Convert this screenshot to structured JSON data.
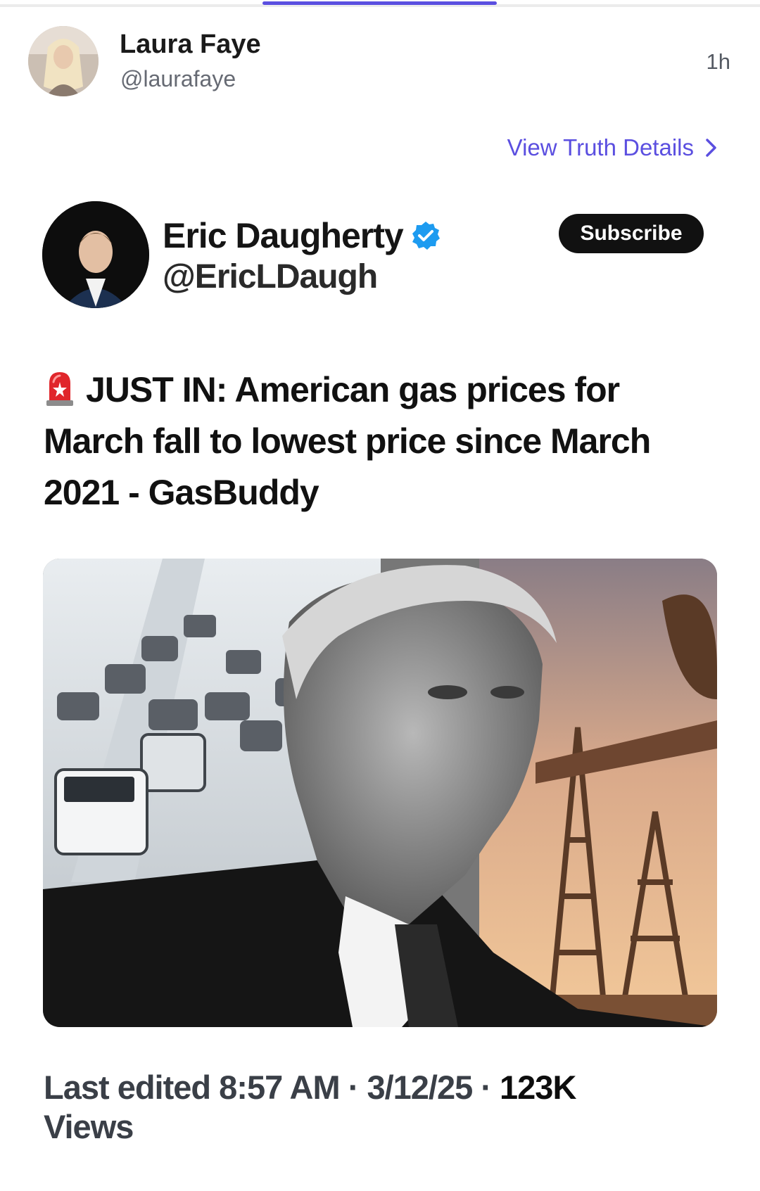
{
  "poster": {
    "name": "Laura Faye",
    "handle": "@laurafaye",
    "time": "1h",
    "view_details_label": "View Truth Details"
  },
  "quoted_post": {
    "author_name": "Eric Daugherty",
    "author_handle": "@EricLDaugh",
    "verified": true,
    "subscribe_label": "Subscribe",
    "headline_emoji": "siren-icon",
    "headline": "JUST IN: American gas prices for March fall to lowest price since March 2021 - GasBuddy",
    "media": "photo-collage",
    "edited_prefix": "Last edited ",
    "edited_time": "8:57 AM",
    "dot": " · ",
    "date": "3/12/25",
    "views_count": "123K",
    "views_label": "Views"
  },
  "colors": {
    "accent": "#5b4fe0",
    "verified": "#1d9bf0",
    "subscribe_bg": "#111111"
  }
}
